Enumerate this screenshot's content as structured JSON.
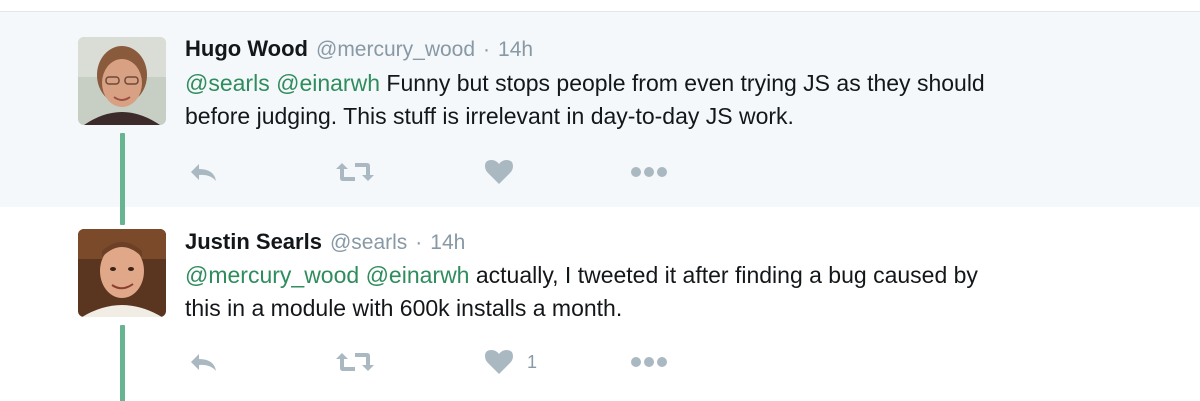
{
  "tweets": [
    {
      "name": "Hugo Wood",
      "handle": "@mercury_wood",
      "separator": "·",
      "time": "14h",
      "mentions": [
        "@searls",
        "@einarwh"
      ],
      "text_line1": "Funny but stops people from even trying JS as they should",
      "text_line2": "before judging. This stuff is irrelevant in day-to-day JS work.",
      "likes": "",
      "background": "#f5f8fa"
    },
    {
      "name": "Justin Searls",
      "handle": "@searls",
      "separator": "·",
      "time": "14h",
      "mentions": [
        "@mercury_wood",
        "@einarwh"
      ],
      "text_line1": "actually, I tweeted it after finding a bug caused by",
      "text_line2": "this in a module with 600k installs a month.",
      "likes": "1",
      "background": "#ffffff"
    }
  ],
  "colors": {
    "mention": "#2f8c5d",
    "thread_line": "#67b491",
    "muted": "#8899a6",
    "action_icon": "#aab8c2"
  },
  "icons": [
    "reply-icon",
    "retweet-icon",
    "like-icon",
    "more-icon"
  ]
}
